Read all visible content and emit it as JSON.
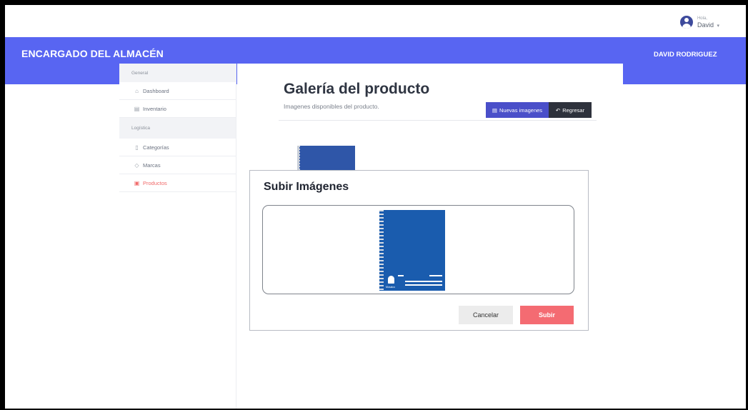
{
  "topbar": {
    "greeting": "Hola,",
    "username": "David",
    "chevron": "▾"
  },
  "header": {
    "app_title": "ENCARGADO DEL ALMACÉN",
    "user_name": "DAVID RODRIGUEZ",
    "color": "#5865f2"
  },
  "sidebar": {
    "section_general": "General",
    "section_logistica": "Logística",
    "items": [
      {
        "label": "Dashboard",
        "icon": "home-icon",
        "glyph": "⌂"
      },
      {
        "label": "Inventario",
        "icon": "building-icon",
        "glyph": "▤"
      },
      {
        "label": "Categorías",
        "icon": "bookmark-icon",
        "glyph": "▯"
      },
      {
        "label": "Marcas",
        "icon": "tag-icon",
        "glyph": "◇"
      },
      {
        "label": "Productos",
        "icon": "box-icon",
        "glyph": "▣",
        "active": true
      }
    ],
    "active_color": "#f06a6a"
  },
  "main": {
    "title": "Galería del producto",
    "subtitle": "Imagenes disponibles del producto.",
    "new_images_button": "Nuevas imagenes",
    "new_images_icon": "▤",
    "back_button": "Regresar",
    "back_icon": "↶"
  },
  "modal": {
    "title": "Subir Imágenes",
    "preview_brand": "Mosaico",
    "cancel_button": "Cancelar",
    "submit_button": "Subir",
    "submit_color": "#f46b72"
  }
}
